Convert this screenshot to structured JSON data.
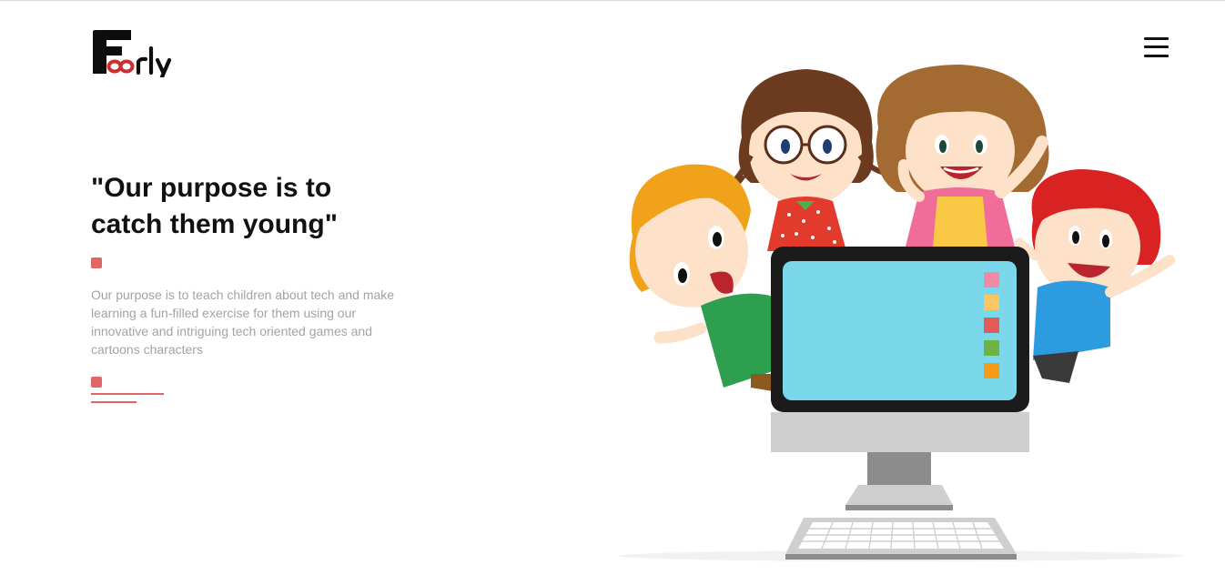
{
  "header": {
    "logo_text": "Foorly",
    "menu_icon": "hamburger-menu-icon"
  },
  "hero": {
    "title_line1": "\"Our purpose is to",
    "title_line2": "catch them young\"",
    "description": "Our purpose is to teach children about tech and make learning a fun-filled exercise for them using our innovative and intriguing tech oriented games and cartoons characters"
  },
  "illustration": {
    "subject": "kids-computer-illustration",
    "swatch_colors": [
      "#f08aa6",
      "#f9c865",
      "#e25a5a",
      "#6bb544",
      "#f59b1a"
    ]
  },
  "colors": {
    "accent": "#e06666",
    "text_dark": "#111111",
    "text_muted": "#a3a3a3",
    "screen": "#7ad8ea"
  }
}
